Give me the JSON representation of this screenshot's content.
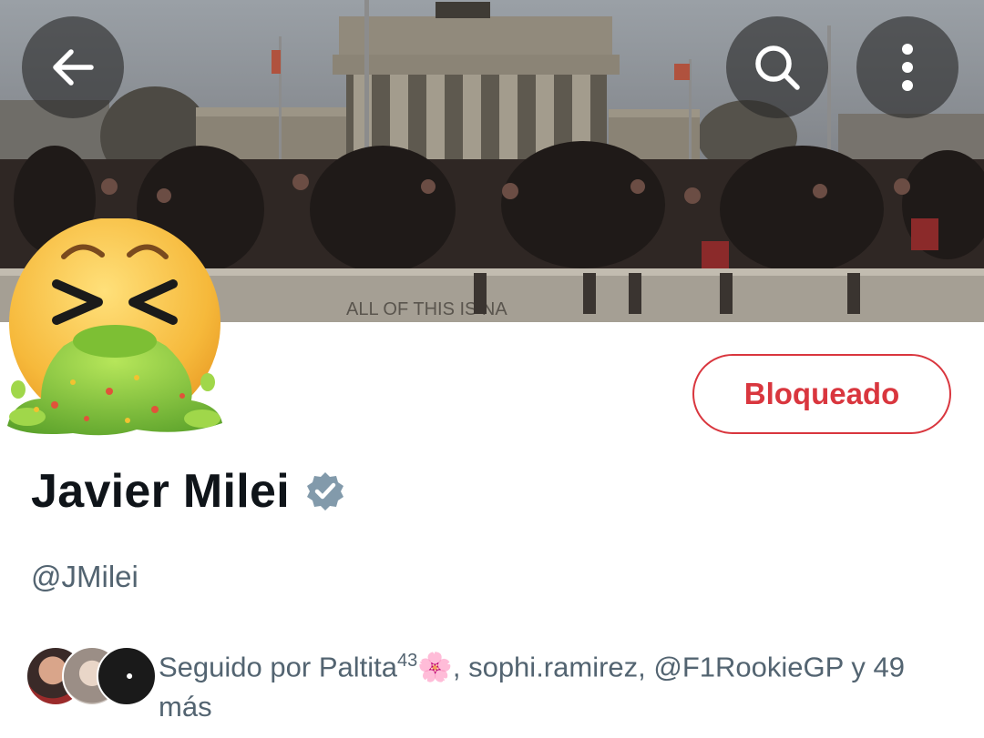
{
  "header": {
    "back_icon": "arrow-left-icon",
    "search_icon": "search-icon",
    "more_icon": "more-vertical-icon"
  },
  "banner": {
    "graffiti_text": "ALL OF THIS IS NA"
  },
  "profile": {
    "avatar_icon": "vomiting-face-emoji",
    "block_button_label": "Bloqueado",
    "name": "Javier Milei",
    "verified_icon": "verified-badge-icon",
    "handle": "@JMilei"
  },
  "followed_by": {
    "prefix": "Seguido por ",
    "user1": "Paltita",
    "user1_sup": "43",
    "user1_emoji": "🌸",
    "separator1": ", ",
    "user2": "sophi.ramirez",
    "separator2": ", ",
    "user3": "@F1RookieGP",
    "suffix": " y 49 más"
  },
  "colors": {
    "accent_red": "#d9363e",
    "secondary_text": "#536471",
    "primary_text": "#0f1419",
    "verified_gray": "#829aab"
  }
}
